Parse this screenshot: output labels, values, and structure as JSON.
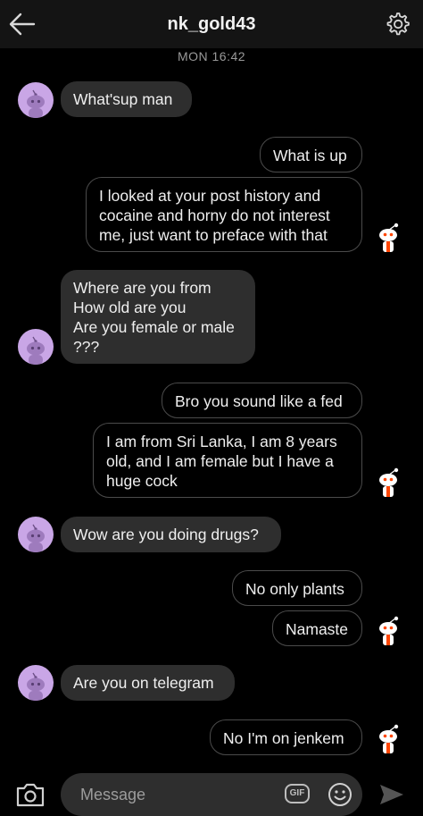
{
  "header": {
    "title": "nk_gold43",
    "back_icon": "arrow-left-icon",
    "settings_icon": "gear-icon"
  },
  "timestamp": "MON 16:42",
  "messages": [
    {
      "from": "them",
      "lines": [
        "What'sup man"
      ]
    },
    {
      "from": "me",
      "lines": [
        "What is up"
      ]
    },
    {
      "from": "me",
      "lines": [
        "I looked at your post history and",
        "cocaine and horny do not interest",
        "me, just want to preface with that"
      ]
    },
    {
      "from": "them",
      "lines": [
        "Where are you from",
        "How old are you",
        "Are you female or male",
        "???"
      ]
    },
    {
      "from": "me",
      "lines": [
        "Bro you sound like a fed"
      ]
    },
    {
      "from": "me",
      "lines": [
        "I am from Sri Lanka, I am 8 years",
        "old, and I am female but I have a",
        "huge cock"
      ]
    },
    {
      "from": "them",
      "lines": [
        "Wow are you doing drugs?"
      ]
    },
    {
      "from": "me",
      "lines": [
        "No only plants"
      ]
    },
    {
      "from": "me",
      "lines": [
        "Namaste"
      ]
    },
    {
      "from": "them",
      "lines": [
        "Are you on telegram"
      ]
    },
    {
      "from": "me",
      "lines": [
        "No I'm on jenkem"
      ]
    }
  ],
  "composer": {
    "placeholder": "Message",
    "gif_label": "GIF",
    "camera_icon": "camera-icon",
    "emoji_icon": "smiley-icon",
    "send_icon": "send-icon"
  },
  "colors": {
    "background": "#000000",
    "header": "#141414",
    "incoming_bubble": "#2e2e2e",
    "outgoing_border": "#4b4b4b",
    "their_avatar": "#c9a6e6"
  }
}
